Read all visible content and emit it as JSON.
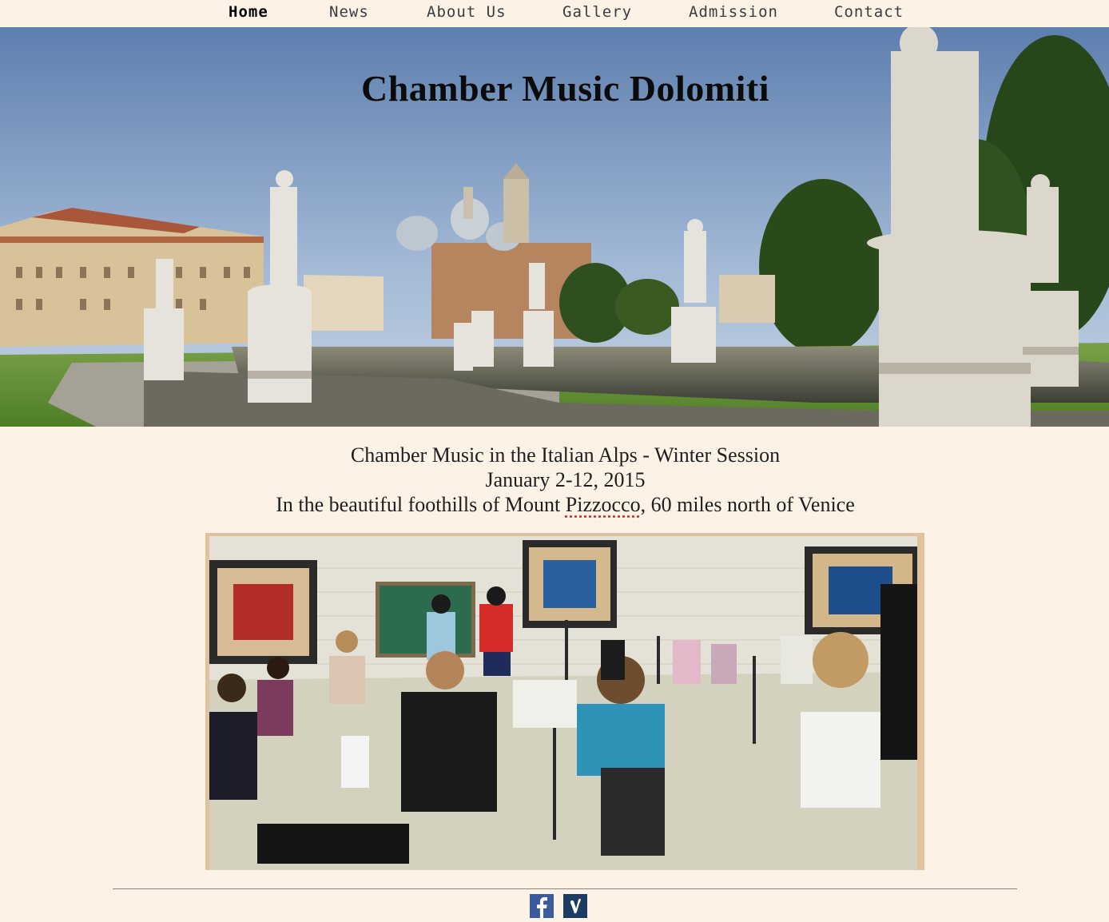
{
  "nav": {
    "items": [
      {
        "label": "Home",
        "active": true
      },
      {
        "label": "News"
      },
      {
        "label": "About Us"
      },
      {
        "label": "Gallery"
      },
      {
        "label": "Admission"
      },
      {
        "label": "Contact"
      }
    ]
  },
  "hero": {
    "title": "Chamber Music Dolomiti"
  },
  "intro": {
    "line1": "Chamber Music in the Italian Alps - Winter Session",
    "line2": "January 2-12, 2015",
    "line3_before": "In the beautiful foothills of Mount ",
    "line3_highlight": "Pizzocco",
    "line3_after": ", 60 miles north of Venice"
  },
  "footer": {
    "social": [
      {
        "icon": "facebook-icon"
      },
      {
        "icon": "vimeo-icon"
      }
    ]
  },
  "colors": {
    "background": "#fcf2e6",
    "frame": "#e2c29c",
    "facebook": "#3b5b9a",
    "vimeo": "#1c3c63"
  }
}
